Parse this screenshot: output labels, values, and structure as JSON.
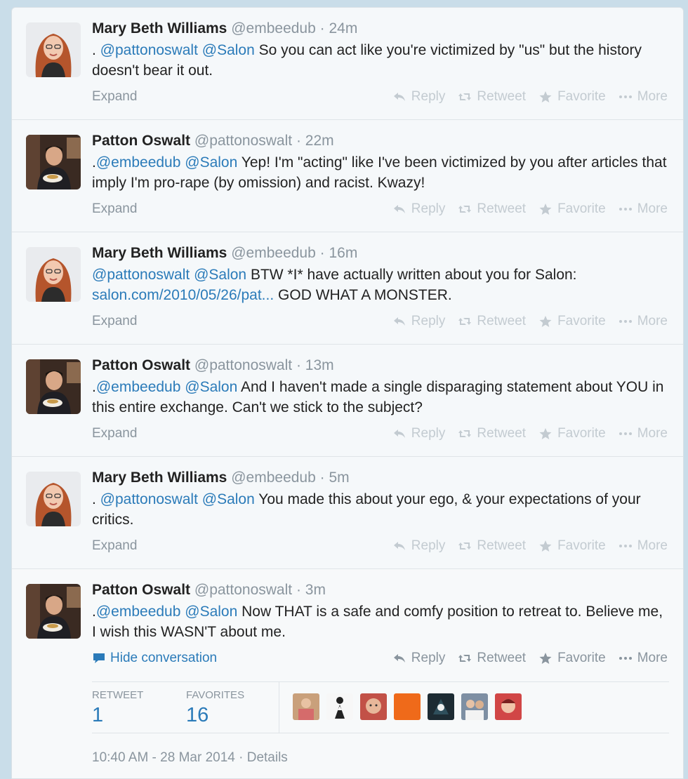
{
  "tweets": [
    {
      "fullname": "Mary Beth Williams",
      "handle": "@embeedub",
      "time": "· 24m",
      "avatar": "mbw",
      "parts": [
        {
          "t": ". ",
          "k": "text"
        },
        {
          "t": "@pattonoswalt",
          "k": "mention"
        },
        {
          "t": " ",
          "k": "text"
        },
        {
          "t": "@Salon",
          "k": "mention"
        },
        {
          "t": " So you can act like you're victimized by \"us\" but the history doesn't bear it out.",
          "k": "text"
        }
      ],
      "footer": "Expand"
    },
    {
      "fullname": "Patton Oswalt",
      "handle": "@pattonoswalt",
      "time": "· 22m",
      "avatar": "po",
      "parts": [
        {
          "t": ".",
          "k": "text"
        },
        {
          "t": "@embeedub",
          "k": "mention"
        },
        {
          "t": " ",
          "k": "text"
        },
        {
          "t": "@Salon",
          "k": "mention"
        },
        {
          "t": " Yep! I'm \"acting\" like I've been victimized by you after articles that imply I'm pro-rape (by omission) and racist. Kwazy!",
          "k": "text"
        }
      ],
      "footer": "Expand"
    },
    {
      "fullname": "Mary Beth Williams",
      "handle": "@embeedub",
      "time": "· 16m",
      "avatar": "mbw",
      "parts": [
        {
          "t": "@pattonoswalt",
          "k": "mention"
        },
        {
          "t": " ",
          "k": "text"
        },
        {
          "t": "@Salon",
          "k": "mention"
        },
        {
          "t": " BTW *I* have actually written about you for Salon: ",
          "k": "text"
        },
        {
          "t": "salon.com/2010/05/26/pat...",
          "k": "link"
        },
        {
          "t": " GOD WHAT A MONSTER.",
          "k": "text"
        }
      ],
      "footer": "Expand"
    },
    {
      "fullname": "Patton Oswalt",
      "handle": "@pattonoswalt",
      "time": "· 13m",
      "avatar": "po",
      "parts": [
        {
          "t": ".",
          "k": "text"
        },
        {
          "t": "@embeedub",
          "k": "mention"
        },
        {
          "t": " ",
          "k": "text"
        },
        {
          "t": "@Salon",
          "k": "mention"
        },
        {
          "t": " And I haven't made a single disparaging statement about YOU in this entire exchange. Can't we stick to the subject?",
          "k": "text"
        }
      ],
      "footer": "Expand"
    },
    {
      "fullname": "Mary Beth Williams",
      "handle": "@embeedub",
      "time": "· 5m",
      "avatar": "mbw",
      "parts": [
        {
          "t": ". ",
          "k": "text"
        },
        {
          "t": "@pattonoswalt",
          "k": "mention"
        },
        {
          "t": " ",
          "k": "text"
        },
        {
          "t": "@Salon",
          "k": "mention"
        },
        {
          "t": " You made this about your ego, & your expectations of your critics.",
          "k": "text"
        }
      ],
      "footer": "Expand"
    },
    {
      "fullname": "Patton Oswalt",
      "handle": "@pattonoswalt",
      "time": "· 3m",
      "avatar": "po",
      "parts": [
        {
          "t": ".",
          "k": "text"
        },
        {
          "t": "@embeedub",
          "k": "mention"
        },
        {
          "t": " ",
          "k": "text"
        },
        {
          "t": "@Salon",
          "k": "mention"
        },
        {
          "t": " Now THAT is a safe and comfy position to retreat to. Believe me, I wish this WASN'T about me.",
          "k": "text"
        }
      ],
      "footer": "Hide conversation"
    }
  ],
  "actions": {
    "reply": "Reply",
    "retweet": "Retweet",
    "favorite": "Favorite",
    "more": "More"
  },
  "icons": {
    "reply": "reply-icon",
    "retweet": "retweet-icon",
    "favorite": "star-icon",
    "more": "more-dots-icon",
    "hide": "speech-bubble-icon"
  },
  "stats": {
    "retweet_label": "RETWEET",
    "retweet_count": "1",
    "favorites_label": "FAVORITES",
    "favorites_count": "16"
  },
  "favoriters": [
    "favoriter-1",
    "favoriter-2",
    "favoriter-3",
    "favoriter-4",
    "favoriter-5",
    "favoriter-6",
    "favoriter-7"
  ],
  "timestamp": "10:40 AM - 28 Mar 2014",
  "details": "· Details",
  "colors": {
    "link": "#2b7bb9",
    "muted": "#8a959e",
    "action_faded": "#c3cbd1"
  }
}
